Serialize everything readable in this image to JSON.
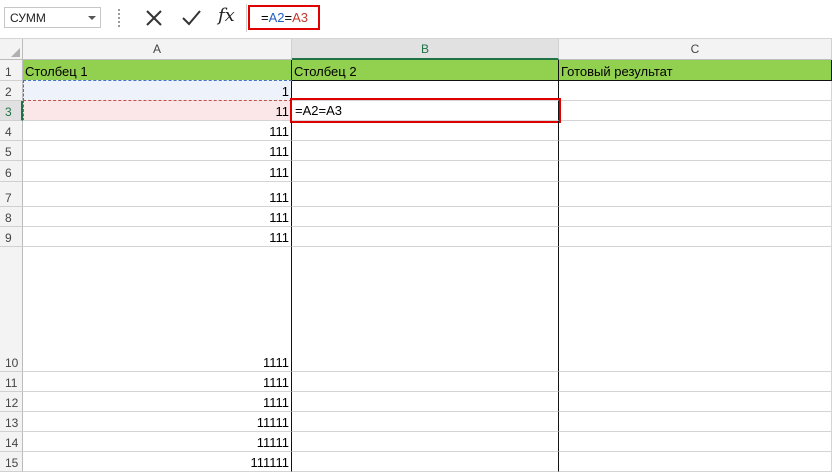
{
  "formula_bar": {
    "name_box": "СУММ",
    "fx_label": "fx",
    "formula_eq": "=",
    "formula_ref1": "A2",
    "formula_eq2": "=",
    "formula_ref2": "A3"
  },
  "columns": [
    "A",
    "B",
    "C"
  ],
  "rows": [
    {
      "n": "1",
      "a": "Столбец 1",
      "b": "Столбец 2",
      "c": "Готовый результат"
    },
    {
      "n": "2",
      "a": "1",
      "b": "",
      "c": ""
    },
    {
      "n": "3",
      "a": "11",
      "b": "=A2=A3",
      "c": ""
    },
    {
      "n": "4",
      "a": "111",
      "b": "",
      "c": ""
    },
    {
      "n": "5",
      "a": "111",
      "b": "",
      "c": ""
    },
    {
      "n": "6",
      "a": "111",
      "b": "",
      "c": ""
    },
    {
      "n": "7",
      "a": "111",
      "b": "",
      "c": ""
    },
    {
      "n": "8",
      "a": "111",
      "b": "",
      "c": ""
    },
    {
      "n": "9",
      "a": "111",
      "b": "",
      "c": ""
    },
    {
      "n": "10",
      "a": "1111",
      "b": "",
      "c": ""
    },
    {
      "n": "11",
      "a": "1111",
      "b": "",
      "c": ""
    },
    {
      "n": "12",
      "a": "1111",
      "b": "",
      "c": ""
    },
    {
      "n": "13",
      "a": "11111",
      "b": "",
      "c": ""
    },
    {
      "n": "14",
      "a": "11111",
      "b": "",
      "c": ""
    },
    {
      "n": "15",
      "a": "111111",
      "b": "",
      "c": ""
    }
  ],
  "colors": {
    "header_fill": "#92d050",
    "edit_border": "#e00000",
    "ref_a2": "#1f5fbf",
    "ref_a3": "#c0392b",
    "selected_accent": "#217346"
  }
}
